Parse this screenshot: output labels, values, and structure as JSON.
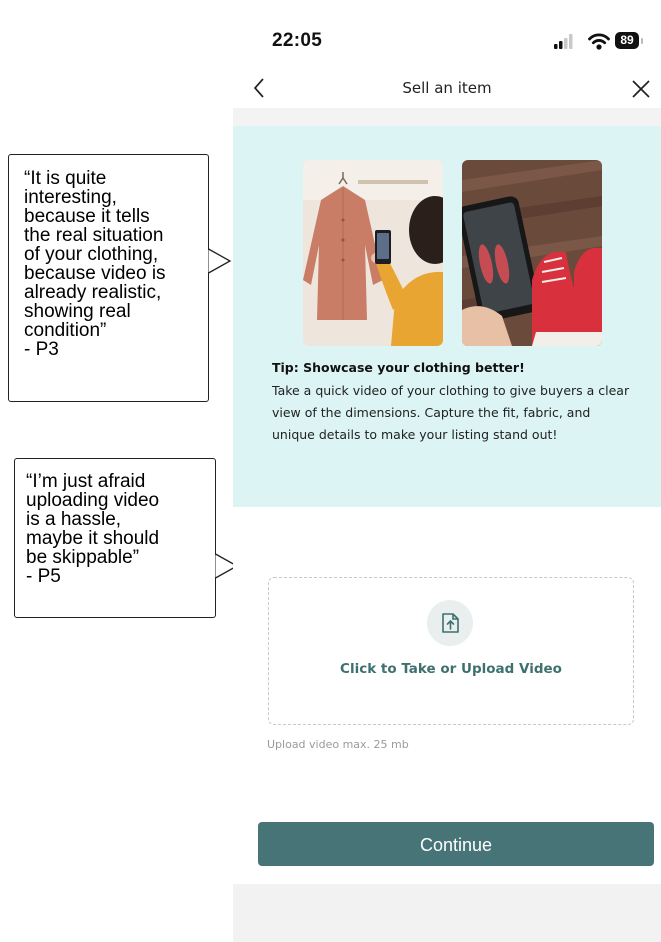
{
  "annotations": [
    {
      "quote": "“It is quite\ninteresting,\nbecause it tells\nthe real situation\nof your clothing,\nbecause video is\nalready realistic,\nshowing real\ncondition”",
      "author": "- P3"
    },
    {
      "quote": "“I’m just afraid\nuploading video\nis a hassle,\nmaybe it should\nbe skippable”",
      "author": "- P5"
    }
  ],
  "status_bar": {
    "time": "22:05",
    "battery": "89",
    "icons": [
      "signal-icon",
      "wifi-icon",
      "battery-icon"
    ]
  },
  "nav": {
    "title": "Sell an item",
    "back_icon": "chevron-left-icon",
    "close_icon": "close-icon"
  },
  "tip": {
    "title": "Tip: Showcase your clothing better!",
    "body": "Take a quick video of your clothing to give buyers a clear view of the dimensions. Capture the fit, fabric, and unique details to make your listing stand out!"
  },
  "upload": {
    "label": "Click to Take or Upload Video",
    "hint": "Upload video max. 25 mb",
    "icon": "upload-file-icon"
  },
  "continue_label": "Continue",
  "colors": {
    "tip_background": "#dcf4f3",
    "accent": "#467477",
    "upload_label": "#3f7070"
  }
}
